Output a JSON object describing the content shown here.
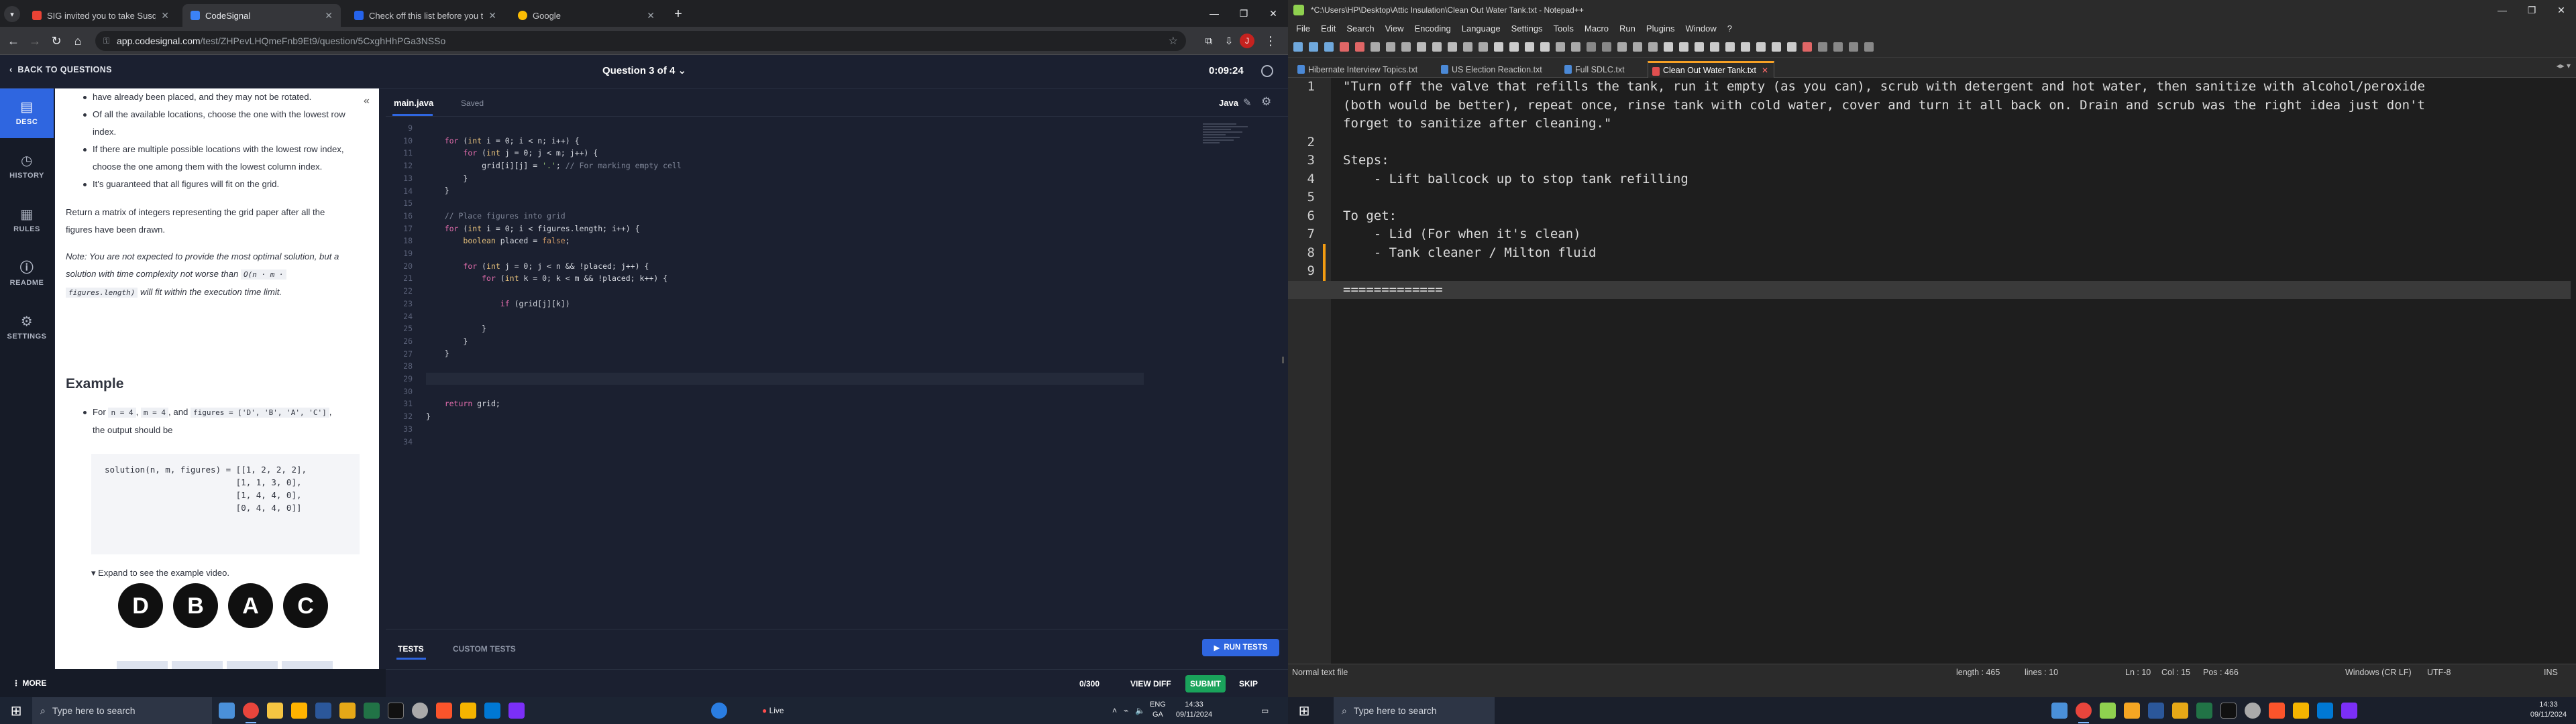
{
  "left": {
    "tabs": [
      {
        "title": "SIG invited you to take Susque",
        "color": "#ea4335"
      },
      {
        "title": "CodeSignal",
        "color": "#3b82f6"
      },
      {
        "title": "Check off this list before you t",
        "color": "#2563eb"
      },
      {
        "title": "Google",
        "color": "#fbbc04"
      }
    ],
    "url_host": "app.codesignal.com",
    "url_path": "/test/ZHPevLHQmeFnb9Et9/question/5CxghHhPGa3NSSo",
    "avatar_letter": "J",
    "back_label": "BACK TO QUESTIONS",
    "question_label": "Question 3 of 4",
    "timer": "0:09:24",
    "nav": [
      {
        "label": "DESC",
        "icon": "▤"
      },
      {
        "label": "HISTORY",
        "icon": "◷"
      },
      {
        "label": "RULES",
        "icon": "▦"
      },
      {
        "label": "README",
        "icon": "ⓘ"
      },
      {
        "label": "SETTINGS",
        "icon": "⚙"
      }
    ],
    "more_label": "MORE",
    "desc": {
      "b0": "have already been placed, and they may not be rotated.",
      "b1a": "Of all the available locations, choose the one with the lowest row",
      "b1b": "index.",
      "b2a": "If there are multiple possible locations with the lowest row index,",
      "b2b": "choose the one among them with the lowest column index.",
      "b3": "It's guaranteed that all figures will fit on the grid.",
      "p1a": "Return a matrix of integers representing the grid paper after all the",
      "p1b": "figures have been drawn.",
      "note_a": "Note: You are not expected to provide the most optimal solution, but a",
      "note_b_pre": "solution with time complexity not worse than",
      "note_code1": "O(n · m ·",
      "note_code2": "figures.length)",
      "note_c": "will fit within the execution time limit.",
      "example_heading": "Example",
      "ex_for": "For",
      "ex_n": "n = 4",
      "ex_m": "m = 4",
      "ex_and": ", and",
      "ex_fig": "figures = ['D', 'B', 'A', 'C']",
      "ex_out": "the output should be",
      "ex_code": "solution(n, m, figures) = [[1, 2, 2, 2],\n                          [1, 1, 3, 0],\n                          [1, 4, 4, 0],\n                          [0, 4, 4, 0]]",
      "expand": "▾ Expand to see the example video.",
      "circles": [
        "D",
        "B",
        "A",
        "C"
      ]
    },
    "editor": {
      "file": "main.java",
      "saved": "Saved",
      "lang": "Java",
      "line_numbers": [
        "9",
        "10",
        "11",
        "12",
        "13",
        "14",
        "15",
        "16",
        "17",
        "18",
        "19",
        "20",
        "21",
        "22",
        "23",
        "24",
        "25",
        "26",
        "27",
        "28",
        "29",
        "30",
        "31",
        "32",
        "33",
        "34"
      ],
      "lines": [
        "",
        "    for (int i = 0; i < n; i++) {",
        "        for (int j = 0; j < m; j++) {",
        "            grid[i][j] = '.'; // For marking empty cell",
        "        }",
        "    }",
        "",
        "    // Place figures into grid",
        "    for (int i = 0; i < figures.length; i++) {",
        "        boolean placed = false;",
        "",
        "        for (int j = 0; j < n && !placed; j++) {",
        "            for (int k = 0; k < m && !placed; k++) {",
        "",
        "                if (grid[j][k])",
        "",
        "            }",
        "        }",
        "    }",
        "",
        "",
        "",
        "    return grid;",
        "}",
        "",
        ""
      ],
      "tests_tab": "TESTS",
      "custom_tab": "CUSTOM TESTS",
      "run_tests": "RUN TESTS",
      "score": "0/300",
      "view_diff": "VIEW DIFF",
      "submit": "SUBMIT",
      "skip": "SKIP"
    },
    "taskbar": {
      "search_placeholder": "Type here to search",
      "live": "Live",
      "lang": "ENG",
      "lang2": "GA",
      "time": "14:33",
      "date": "09/11/2024"
    }
  },
  "right": {
    "title": "*C:\\Users\\HP\\Desktop\\Attic Insulation\\Clean Out Water Tank.txt - Notepad++",
    "menu": [
      "File",
      "Edit",
      "Search",
      "View",
      "Encoding",
      "Language",
      "Settings",
      "Tools",
      "Macro",
      "Run",
      "Plugins",
      "Window",
      "?"
    ],
    "tabs": [
      "Hibernate Interview Topics.txt",
      "US Election Reaction.txt",
      "Full SDLC.txt",
      "Clean Out Water Tank.txt"
    ],
    "active_tab": 3,
    "line_numbers": [
      "1",
      "",
      "",
      "2",
      "3",
      "4",
      "5",
      "6",
      "7",
      "8",
      "9",
      "10"
    ],
    "lines": [
      "\"Turn off the valve that refills the tank, run it empty (as you can), scrub with detergent and hot water, then sanitize with alcohol/peroxide",
      "(both would be better), repeat once, rinse tank with cold water, cover and turn it all back on. Drain and scrub was the right idea just don't",
      "forget to sanitize after cleaning.\"",
      "",
      "Steps:",
      "    - Lift ballcock up to stop tank refilling",
      "",
      "To get:",
      "    - Lid (For when it's clean)",
      "    - Tank cleaner / Milton fluid",
      "",
      "============="
    ],
    "status": {
      "type": "Normal text file",
      "length": "length : 465",
      "lines": "lines : 10",
      "ln": "Ln : 10",
      "col": "Col : 15",
      "pos": "Pos : 466",
      "eol": "Windows (CR LF)",
      "enc": "UTF-8",
      "ins": "INS"
    },
    "taskbar": {
      "search_placeholder": "Type here to search",
      "time": "14:33",
      "date": "09/11/2024"
    }
  }
}
